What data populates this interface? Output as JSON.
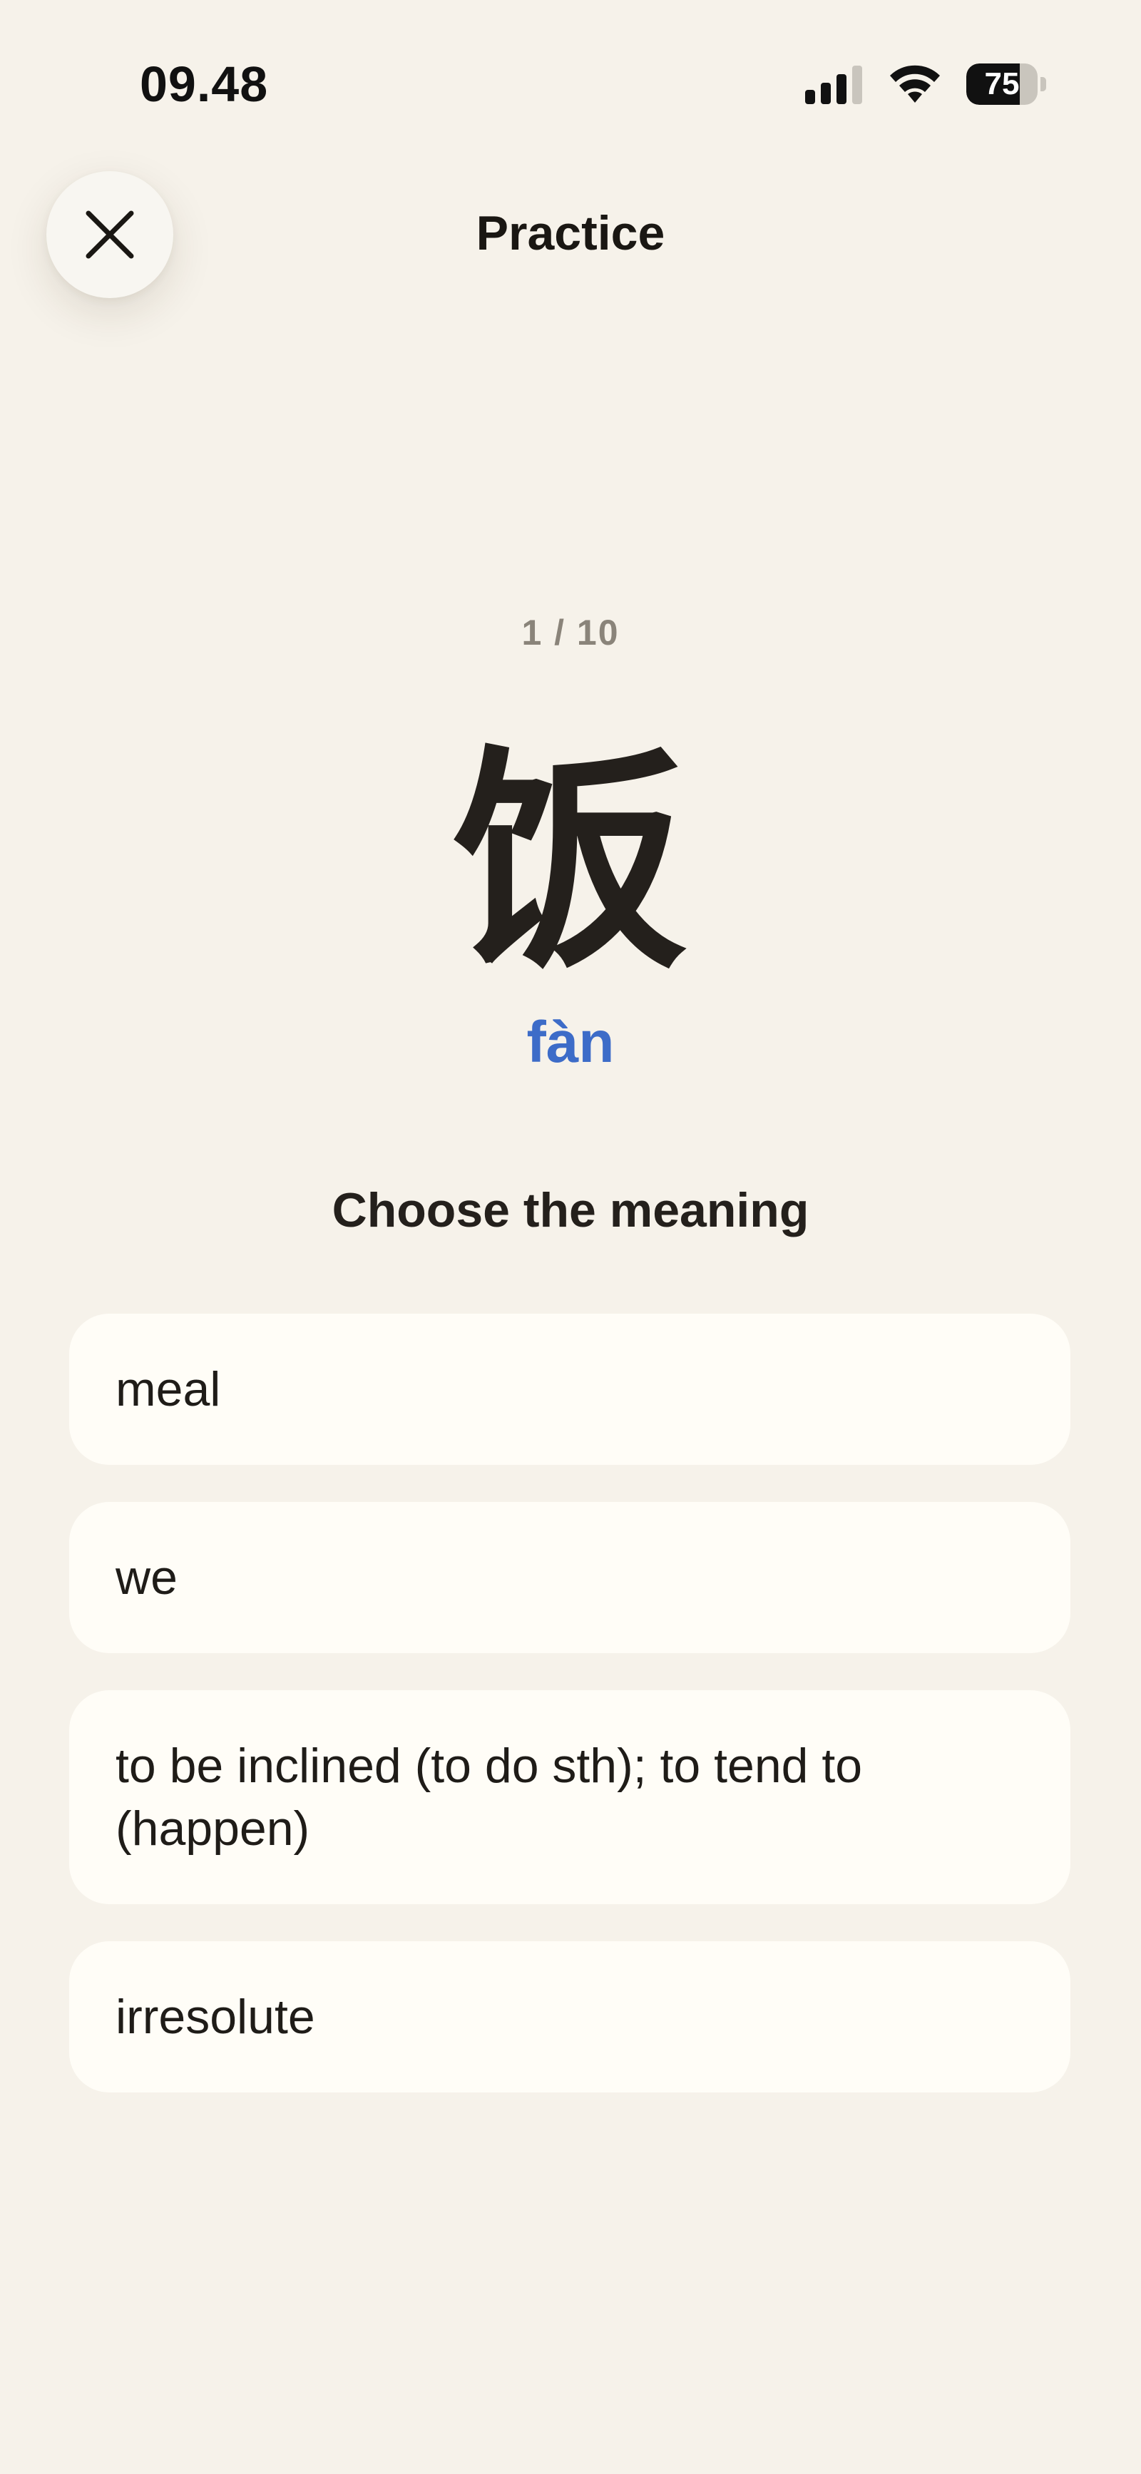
{
  "status_bar": {
    "time": "09.48",
    "battery_level": 75,
    "battery_text": "75",
    "signal_icon": "cellular-signal-icon",
    "wifi_icon": "wifi-icon"
  },
  "header": {
    "title": "Practice",
    "close_icon": "close-icon"
  },
  "quiz": {
    "progress": "1 / 10",
    "character": "饭",
    "pinyin": "fàn",
    "prompt": "Choose the meaning",
    "options": [
      {
        "label": "meal"
      },
      {
        "label": "we"
      },
      {
        "label": "to be inclined (to do sth); to tend to (happen)"
      },
      {
        "label": "irresolute"
      }
    ]
  },
  "colors": {
    "background": "#f6f2ea",
    "option_background": "#fffdf7",
    "pinyin": "#3d6cc8",
    "progress": "#8a847a",
    "text": "#1f1c18"
  }
}
